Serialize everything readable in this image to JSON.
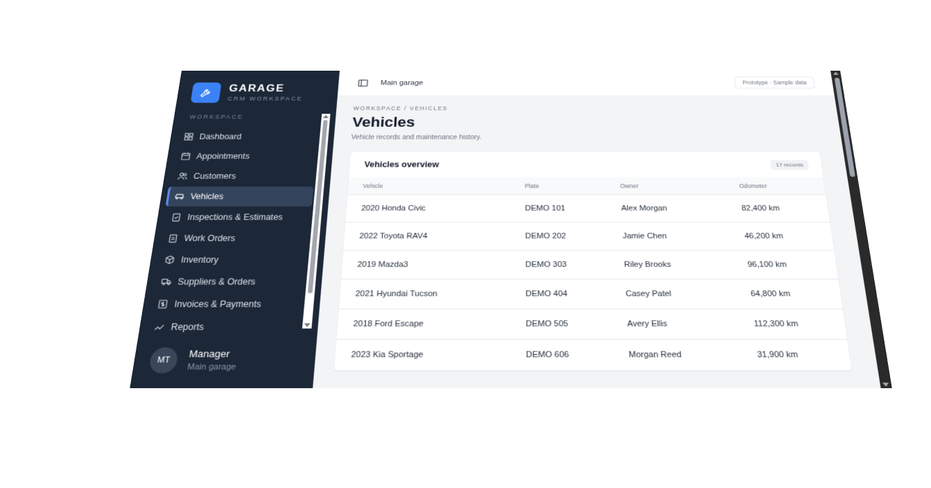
{
  "brand": {
    "name": "GARAGE",
    "subtitle": "CRM WORKSPACE",
    "icon": "wrench-icon"
  },
  "sidebar": {
    "section_label": "WORKSPACE",
    "items": [
      {
        "label": "Dashboard",
        "icon": "dashboard-icon"
      },
      {
        "label": "Appointments",
        "icon": "calendar-icon"
      },
      {
        "label": "Customers",
        "icon": "users-icon"
      },
      {
        "label": "Vehicles",
        "icon": "car-icon",
        "active": true
      },
      {
        "label": "Inspections & Estimates",
        "icon": "clipboard-check-icon"
      },
      {
        "label": "Work Orders",
        "icon": "clipboard-list-icon"
      },
      {
        "label": "Inventory",
        "icon": "box-icon"
      },
      {
        "label": "Suppliers & Orders",
        "icon": "truck-icon"
      },
      {
        "label": "Invoices & Payments",
        "icon": "invoice-icon"
      },
      {
        "label": "Reports",
        "icon": "chart-line-icon"
      }
    ]
  },
  "user": {
    "initials": "MT",
    "name": "Manager",
    "location": "Main garage"
  },
  "topbar": {
    "location": "Main garage",
    "badge": "Prototype · Sample data"
  },
  "page": {
    "breadcrumb": "WORKSPACE / VEHICLES",
    "title": "Vehicles",
    "subtitle": "Vehicle records and maintenance history."
  },
  "card": {
    "title": "Vehicles overview",
    "count": "17 records",
    "columns": [
      "Vehicle",
      "Plate",
      "Owner",
      "Odometer"
    ],
    "rows": [
      [
        "2020 Honda Civic",
        "DEMO 101",
        "Alex Morgan",
        "82,400 km"
      ],
      [
        "2022 Toyota RAV4",
        "DEMO 202",
        "Jamie Chen",
        "46,200 km"
      ],
      [
        "2019 Mazda3",
        "DEMO 303",
        "Riley Brooks",
        "96,100 km"
      ],
      [
        "2021 Hyundai Tucson",
        "DEMO 404",
        "Casey Patel",
        "64,800 km"
      ],
      [
        "2018 Ford Escape",
        "DEMO 505",
        "Avery Ellis",
        "112,300 km"
      ],
      [
        "2023 Kia Sportage",
        "DEMO 606",
        "Morgan Reed",
        "31,900 km"
      ]
    ]
  }
}
